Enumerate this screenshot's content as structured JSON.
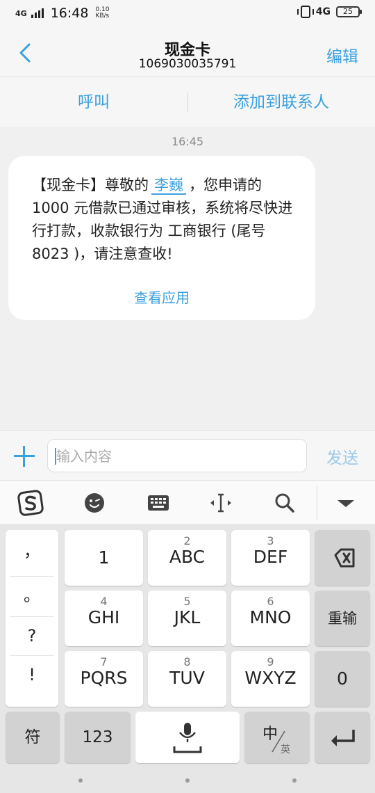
{
  "status_bar": {
    "network_left": "4G",
    "time": "16:48",
    "speed_value": "0.10",
    "speed_unit": "KB/s",
    "network_right": "4G",
    "battery": "25"
  },
  "header": {
    "title": "现金卡",
    "number": "1069030035791",
    "edit_label": "编辑"
  },
  "actions": {
    "call_label": "呼叫",
    "add_contact_label": "添加到联系人"
  },
  "messages": {
    "timestamp": "16:45",
    "text_before_name": "【现金卡】尊敬的",
    "name": "李巍",
    "text_after_name": "，您申请的 1000 元借款已通过审核，系统将尽快进行打款，收款银行为 工商银行 (尾号 8023 )，请注意查收!",
    "view_app_label": "查看应用"
  },
  "input": {
    "placeholder": "输入内容",
    "value": "",
    "send_label": "发送"
  },
  "keyboard": {
    "symbols": [
      "，",
      "。",
      "?",
      "!"
    ],
    "keys": [
      {
        "sub": "",
        "main": "1"
      },
      {
        "sub": "2",
        "main": "ABC"
      },
      {
        "sub": "3",
        "main": "DEF"
      },
      {
        "sub": "4",
        "main": "GHI"
      },
      {
        "sub": "5",
        "main": "JKL"
      },
      {
        "sub": "6",
        "main": "MNO"
      },
      {
        "sub": "7",
        "main": "PQRS"
      },
      {
        "sub": "8",
        "main": "TUV"
      },
      {
        "sub": "9",
        "main": "WXYZ"
      }
    ],
    "reenter_label": "重输",
    "zero_label": "0",
    "symbol_key_label": "符",
    "num_key_label": "123",
    "lang_key_cn": "中",
    "lang_key_en": "英"
  },
  "colors": {
    "accent": "#3aa0e0",
    "send_disabled": "#9cc9ea"
  }
}
